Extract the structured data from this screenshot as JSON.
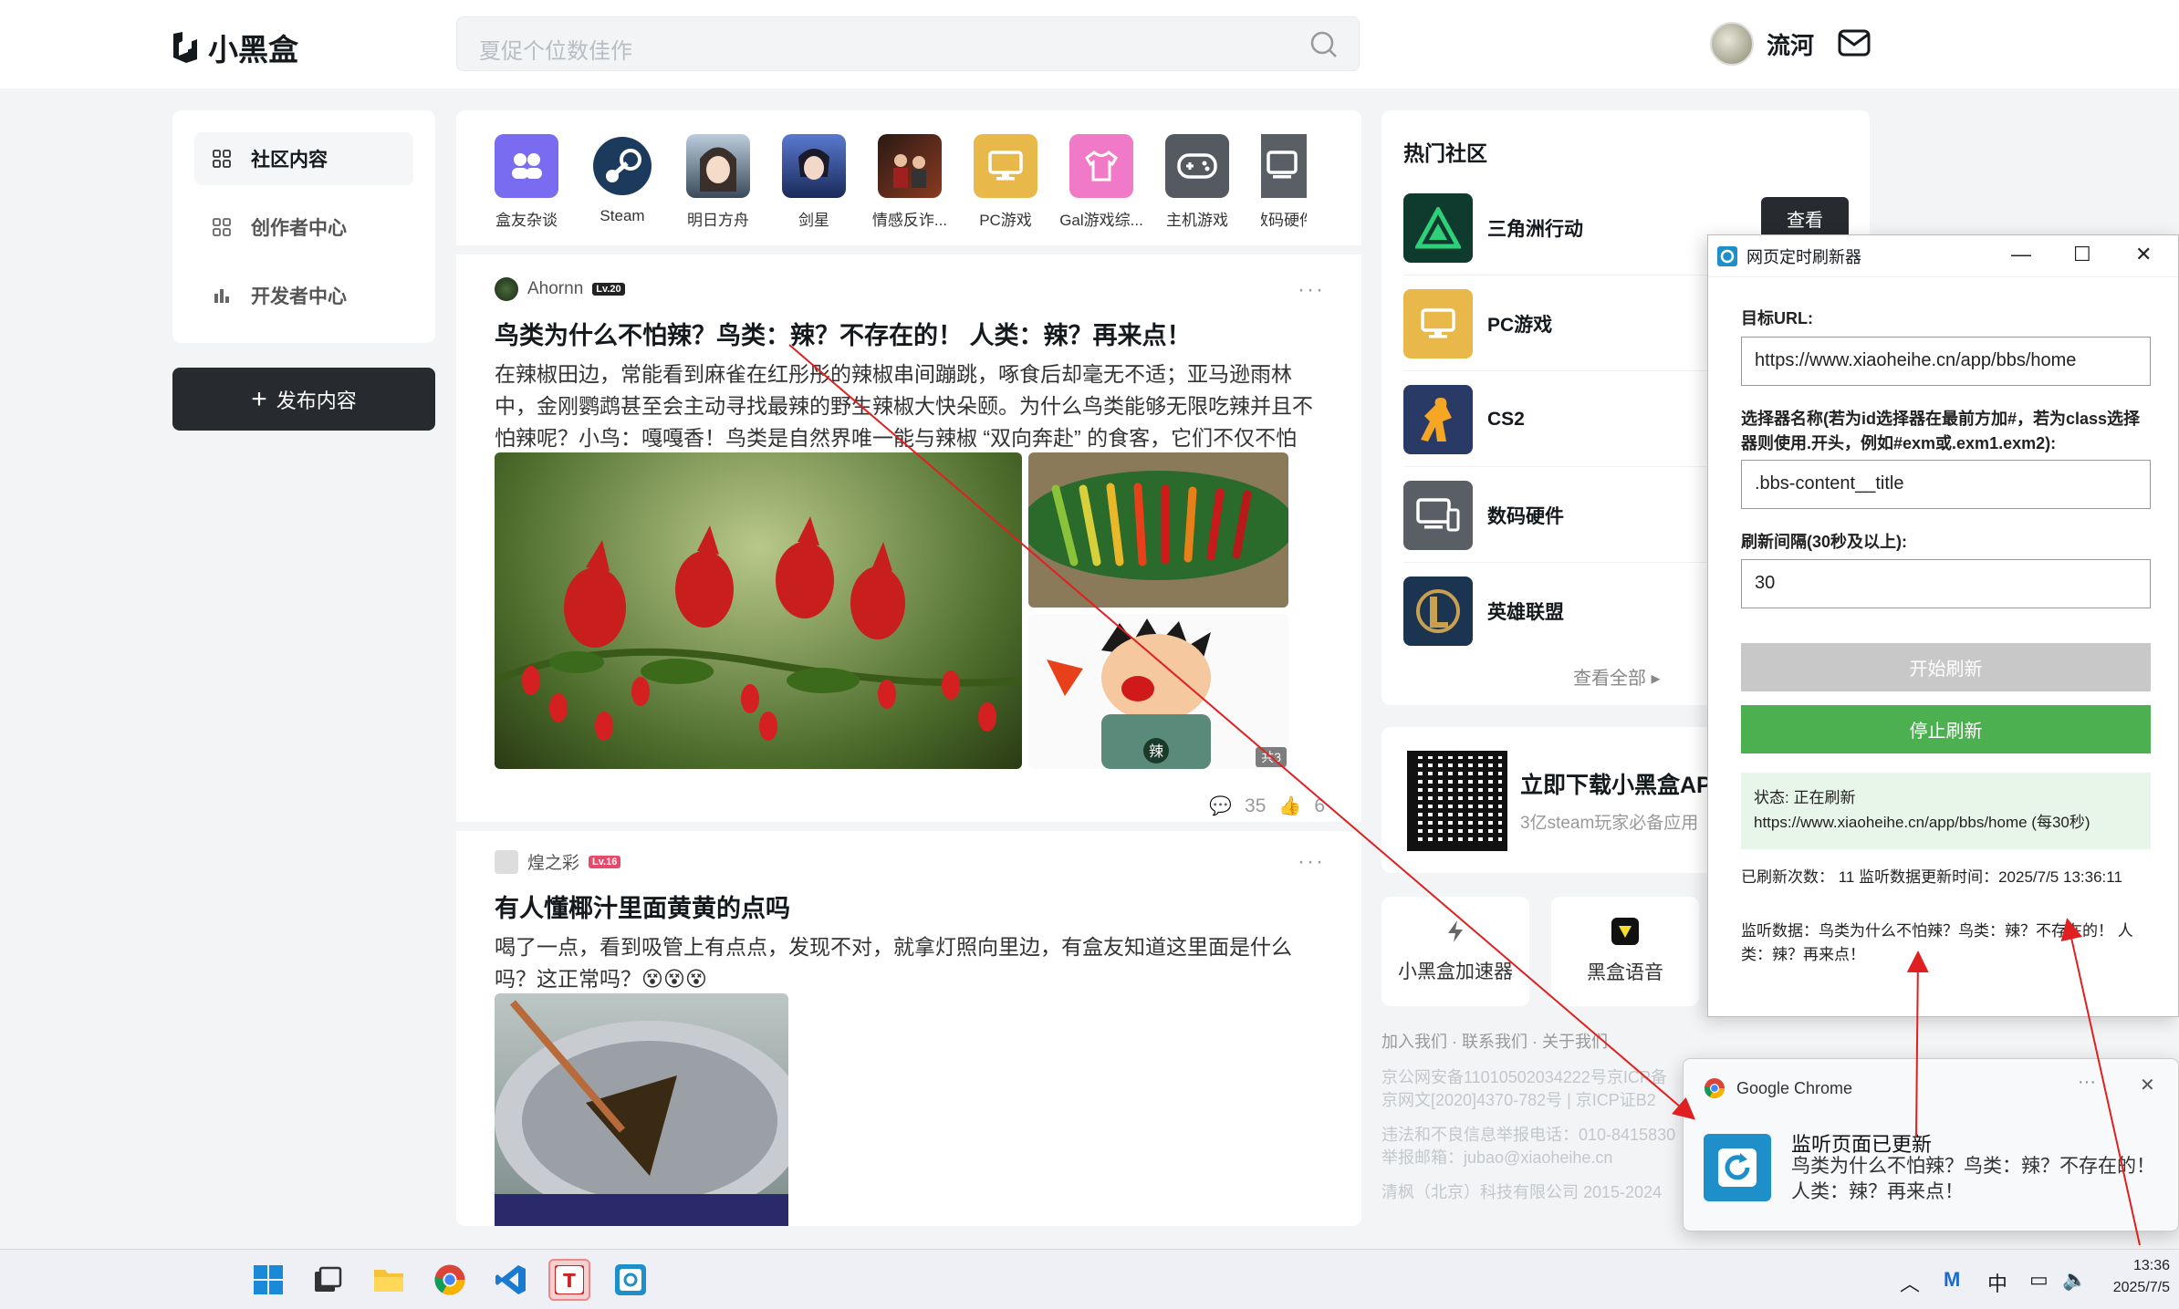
{
  "header": {
    "logo_text": "小黑盒",
    "search_placeholder": "夏促个位数佳作",
    "username": "流河"
  },
  "leftnav": {
    "items": [
      {
        "label": "社区内容",
        "active": true
      },
      {
        "label": "创作者中心",
        "active": false
      },
      {
        "label": "开发者中心",
        "active": false
      }
    ],
    "post_button": "发布内容"
  },
  "categories": [
    {
      "label": "盒友杂谈",
      "color": "#7a6cf0"
    },
    {
      "label": "Steam",
      "color": "#1b3a5c"
    },
    {
      "label": "明日方舟",
      "color": "#3a4a5a"
    },
    {
      "label": "剑星",
      "color": "#2a4a8a"
    },
    {
      "label": "情感反诈...",
      "color": "#6a3020"
    },
    {
      "label": "PC游戏",
      "color": "#e8b84a"
    },
    {
      "label": "Gal游戏综...",
      "color": "#f07ac8"
    },
    {
      "label": "主机游戏",
      "color": "#555a60"
    },
    {
      "label": "数码硬件",
      "color": "#5a5f66"
    }
  ],
  "posts": [
    {
      "author": "Ahornn",
      "level": "Lv.20",
      "title": "鸟类为什么不怕辣？鸟类：辣？不存在的！ 人类：辣？再来点！",
      "body": "在辣椒田边，常能看到麻雀在红彤彤的辣椒串间蹦跳，啄食后却毫无不适；亚马逊雨林中，金刚鹦鹉甚至会主动寻找最辣的野生辣椒大快朵颐。为什么鸟类能够无限吃辣并且不怕辣呢？小鸟：嘎嘎香！鸟类是自然界唯一能与辣椒 “双向奔赴” 的食客，它们不仅不怕辣...",
      "badge": "共3",
      "comments": "35",
      "likes": "6"
    },
    {
      "author": "煌之彩",
      "level": "Lv.16",
      "title": "有人懂椰汁里面黄黄的点吗",
      "body": "喝了一点，看到吸管上有点点，发现不对，就拿灯照向里边，有盒友知道这里面是什么吗？这正常吗？😵😵😵"
    }
  ],
  "hot": {
    "title": "热门社区",
    "view_button": "查看",
    "see_all": "查看全部",
    "communities": [
      {
        "name": "三角洲行动",
        "color": "#0f3b2e"
      },
      {
        "name": "PC游戏",
        "color": "#e8b84a"
      },
      {
        "name": "CS2",
        "color": "#2a3a66"
      },
      {
        "name": "数码硬件",
        "color": "#5a5f66"
      },
      {
        "name": "英雄联盟",
        "color": "#1b3550"
      }
    ]
  },
  "download": {
    "title": "立即下载小黑盒APP",
    "subtitle": "3亿steam玩家必备应用"
  },
  "mini_apps": [
    {
      "label": "小黑盒加速器"
    },
    {
      "label": "黑盒语音"
    }
  ],
  "footer": {
    "links": "加入我们 · 联系我们 · 关于我们",
    "lines": [
      "京公网安备11010502034222号京ICP备",
      "京网文[2020]4370-782号 | 京ICP证B2",
      "违法和不良信息举报电话：010-8415830",
      "举报邮箱：jubao@xiaoheihe.cn",
      "清枫（北京）科技有限公司 2015-2024"
    ]
  },
  "refresher": {
    "window_title": "网页定时刷新器",
    "url_label": "目标URL:",
    "url_value": "https://www.xiaoheihe.cn/app/bbs/home",
    "selector_label": "选择器名称(若为id选择器在最前方加#，若为class选择器则使用.开头，例如#exm或.exm1.exm2):",
    "selector_value": ".bbs-content__title",
    "interval_label": "刷新间隔(30秒及以上):",
    "interval_value": "30",
    "start_button": "开始刷新",
    "stop_button": "停止刷新",
    "status_line1": "状态: 正在刷新",
    "status_line2": "https://www.xiaoheihe.cn/app/bbs/home (每30秒)",
    "refresh_count": "已刷新次数： 11   监听数据更新时间：2025/7/5 13:36:11",
    "monitor_data": "监听数据：鸟类为什么不怕辣？鸟类：辣？不存在的！ 人类：辣？再来点！"
  },
  "notification": {
    "app": "Google Chrome",
    "title": "监听页面已更新",
    "body": "鸟类为什么不怕辣？鸟类：辣？不存在的！ 人类：辣？再来点！"
  },
  "taskbar": {
    "ime": "中",
    "time": "13:36",
    "date": "2025/7/5"
  },
  "colors": {
    "accent_dark": "#272b30",
    "stop_green": "#4caf50",
    "start_gray": "#c8c8c8",
    "annotation_red": "#e02020"
  }
}
